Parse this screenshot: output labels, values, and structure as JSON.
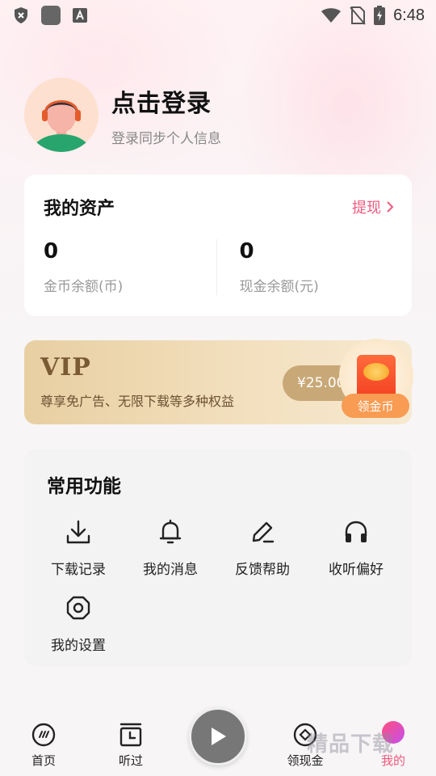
{
  "status_bar": {
    "time": "6:48",
    "icons": [
      "shield-x-icon",
      "app-square-icon",
      "a-letter-icon",
      "wifi-icon",
      "no-sim-icon",
      "battery-charging-icon"
    ]
  },
  "profile": {
    "title": "点击登录",
    "subtitle": "登录同步个人信息"
  },
  "assets": {
    "title": "我的资产",
    "withdraw_label": "提现",
    "coin_balance": "0",
    "coin_label": "金币余额(币)",
    "cash_balance": "0",
    "cash_label": "现金余额(元)"
  },
  "vip": {
    "title": "VIP",
    "subtitle": "尊享免广告、无限下载等多种权益",
    "price": "¥25.00",
    "get_coin_label": "领金币"
  },
  "functions": {
    "title": "常用功能",
    "items": [
      {
        "label": "下载记录",
        "icon": "download-icon"
      },
      {
        "label": "我的消息",
        "icon": "bell-icon"
      },
      {
        "label": "反馈帮助",
        "icon": "edit-icon"
      },
      {
        "label": "收听偏好",
        "icon": "headphones-icon"
      },
      {
        "label": "我的设置",
        "icon": "settings-icon"
      }
    ]
  },
  "bottom_nav": {
    "items": [
      {
        "label": "首页",
        "icon": "home-dial-icon"
      },
      {
        "label": "听过",
        "icon": "history-clock-icon"
      },
      {
        "label": "领现金",
        "icon": "cash-diamond-icon"
      },
      {
        "label": "我的",
        "icon": "profile-dot-icon",
        "active": true
      }
    ],
    "accent": "#f05a7e"
  },
  "watermark": "精品下载",
  "colors": {
    "accent": "#f05a7e",
    "vip_gold": "#7a5a33",
    "coin_orange": "#f89b53"
  }
}
